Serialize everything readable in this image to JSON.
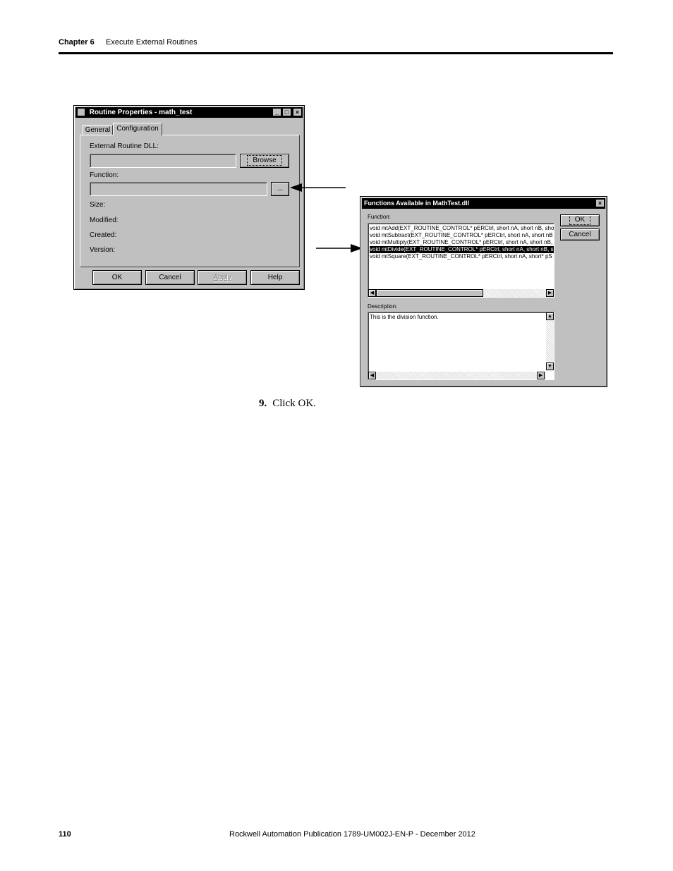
{
  "header": {
    "chapter": "Chapter 6",
    "title": "Execute External Routines"
  },
  "dialog1": {
    "title": "Routine Properties - math_test",
    "tabs": [
      "General",
      "Configuration"
    ],
    "external_dll_label": "External Routine DLL:",
    "browse_label": "Browse",
    "function_label": "Function:",
    "ellipsis_label": "...",
    "size_label": "Size:",
    "modified_label": "Modified:",
    "created_label": "Created:",
    "version_label": "Version:",
    "ok_label": "OK",
    "cancel_label": "Cancel",
    "apply_label": "Apply",
    "help_label": "Help"
  },
  "dialog2": {
    "title": "Functions Available in MathTest.dll",
    "function_label": "Function:",
    "functions": [
      "void mtAdd(EXT_ROUTINE_CONTROL* pERCtrl, short nA, short nB, sho",
      "void mtSubtract(EXT_ROUTINE_CONTROL* pERCtrl, short nA, short nB",
      "void mtMultiply(EXT_ROUTINE_CONTROL* pERCtrl, short nA, short nB,",
      "void mtDivide(EXT_ROUTINE_CONTROL* pERCtrl, short nA, short nB, s",
      "void mtSquare(EXT_ROUTINE_CONTROL* pERCtrl, short nA, short* pS"
    ],
    "selected_index": 3,
    "description_label": "Description:",
    "description": "This is the division function.",
    "ok_label": "OK",
    "cancel_label": "Cancel"
  },
  "step": {
    "number": "9.",
    "text": "Click OK."
  },
  "footer": {
    "page_number": "110",
    "publication": "Rockwell Automation Publication 1789-UM002J-EN-P - December 2012"
  }
}
